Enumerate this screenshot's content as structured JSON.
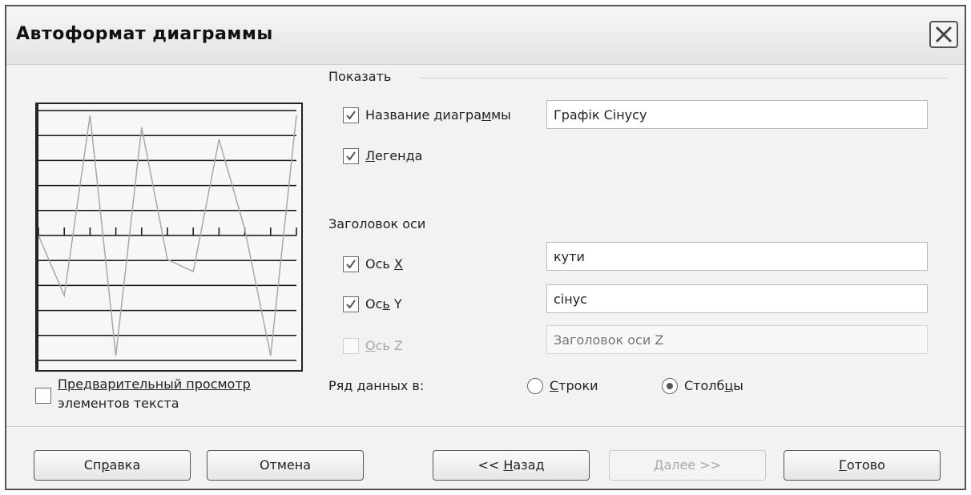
{
  "window": {
    "title": "Автоформат диаграммы",
    "close_icon": "close-icon"
  },
  "preview": {
    "chart_data": {
      "type": "line",
      "x": [
        1,
        2,
        3,
        4,
        5,
        6,
        7,
        8,
        9,
        10,
        11
      ],
      "values": [
        0,
        -0.5,
        1,
        -1,
        0.9,
        -0.2,
        -0.3,
        0.8,
        0.05,
        -1,
        1
      ],
      "grid": true
    },
    "show_text_preview_label": "Предварительный просмотр",
    "show_text_preview_label2": "элементов текста",
    "show_text_preview_checked": false
  },
  "show_group": {
    "label": "Показать",
    "chart_title": {
      "label_pre": "Название диагра",
      "label_u": "м",
      "label_post": "мы",
      "checked": true,
      "value": "Графік Сінусу"
    },
    "legend": {
      "label_u": "Л",
      "label_post": "егенда",
      "checked": true
    }
  },
  "axis_group": {
    "label": "Заголовок оси",
    "x": {
      "label_pre": "Ось ",
      "label_u": "X",
      "checked": true,
      "value": "кути"
    },
    "y": {
      "label_pre": "Ос",
      "label_u": "ь",
      "label_post": " Y",
      "checked": true,
      "value": "сінус"
    },
    "z": {
      "label_u": "О",
      "label_post": "сь Z",
      "checked": false,
      "disabled": true,
      "placeholder": "Заголовок оси Z"
    }
  },
  "series_in": {
    "label": "Ряд данных в:",
    "rows": {
      "label_u": "С",
      "label_post": "троки",
      "selected": false
    },
    "columns": {
      "label_pre": "Столб",
      "label_u": "ц",
      "label_post": "ы",
      "selected": true
    }
  },
  "buttons": {
    "help": {
      "label_pre": "Сп",
      "label_u": "р",
      "label_post": "авка"
    },
    "cancel": {
      "label": "Отмена"
    },
    "back": {
      "label_pre": "<< ",
      "label_u": "Н",
      "label_post": "азад"
    },
    "next": {
      "label": "Далее >>",
      "disabled": true
    },
    "finish": {
      "label_u": "Г",
      "label_post": "отово"
    }
  }
}
